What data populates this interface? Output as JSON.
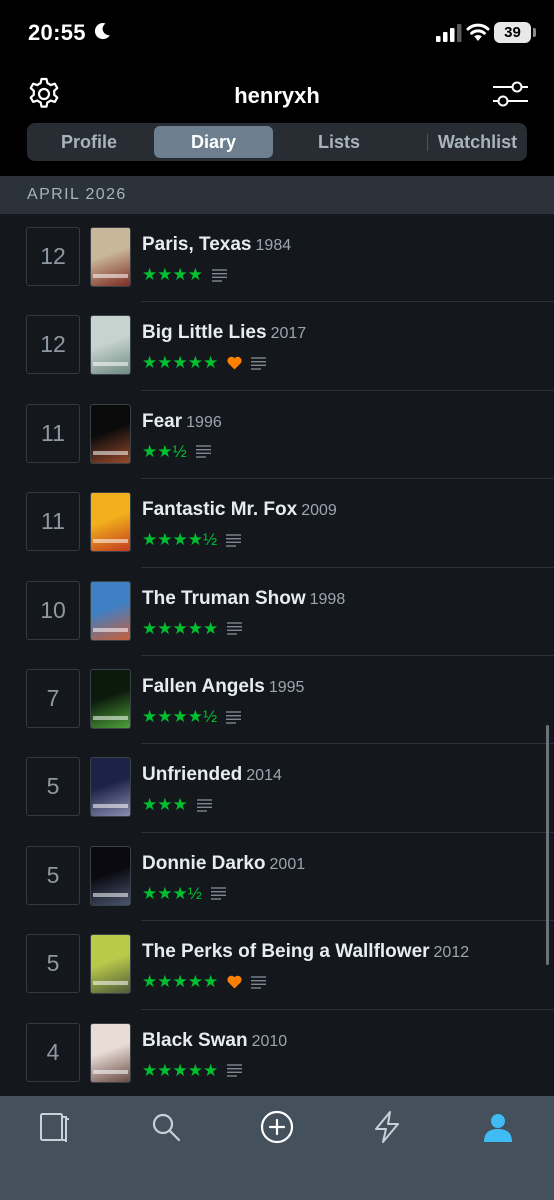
{
  "status_bar": {
    "time": "20:55",
    "battery": "39"
  },
  "header": {
    "username": "henryxh"
  },
  "tabs": [
    {
      "label": "Profile"
    },
    {
      "label": "Diary"
    },
    {
      "label": "Lists"
    },
    {
      "label": "Watchlist"
    }
  ],
  "active_tab": "Diary",
  "month_header": "APRIL 2026",
  "entries": [
    {
      "day": "12",
      "title": "Paris, Texas",
      "year": "1984",
      "rating": "★★★★",
      "liked": false,
      "poster_colors": [
        "#c9b79a",
        "#7c2a22"
      ]
    },
    {
      "day": "12",
      "title": "Big Little Lies",
      "year": "2017",
      "rating": "★★★★★",
      "liked": true,
      "poster_colors": [
        "#c7d3cf",
        "#6f8a83"
      ]
    },
    {
      "day": "11",
      "title": "Fear",
      "year": "1996",
      "rating": "★★½",
      "liked": false,
      "poster_colors": [
        "#0b0b0b",
        "#9a4a2c"
      ]
    },
    {
      "day": "11",
      "title": "Fantastic Mr. Fox",
      "year": "2009",
      "rating": "★★★★½",
      "liked": false,
      "poster_colors": [
        "#f2b11c",
        "#c23a1e"
      ]
    },
    {
      "day": "10",
      "title": "The Truman Show",
      "year": "1998",
      "rating": "★★★★★",
      "liked": false,
      "poster_colors": [
        "#3f7fc4",
        "#c95f38"
      ]
    },
    {
      "day": "7",
      "title": "Fallen Angels",
      "year": "1995",
      "rating": "★★★★½",
      "liked": false,
      "poster_colors": [
        "#0c1a0c",
        "#4fa23a"
      ]
    },
    {
      "day": "5",
      "title": "Unfriended",
      "year": "2014",
      "rating": "★★★",
      "liked": false,
      "poster_colors": [
        "#1d2247",
        "#8b8fb2"
      ]
    },
    {
      "day": "5",
      "title": "Donnie Darko",
      "year": "2001",
      "rating": "★★★½",
      "liked": false,
      "poster_colors": [
        "#0a0a10",
        "#4a5470"
      ]
    },
    {
      "day": "5",
      "title": "The Perks of Being a Wallflower",
      "year": "2012",
      "rating": "★★★★★",
      "liked": true,
      "poster_colors": [
        "#b9c94a",
        "#4f5a3a"
      ]
    },
    {
      "day": "4",
      "title": "Black Swan",
      "year": "2010",
      "rating": "★★★★★",
      "liked": false,
      "poster_colors": [
        "#e8dcd6",
        "#6a4a44"
      ]
    }
  ],
  "colors": {
    "rating_green": "#00c030",
    "like_orange": "#ff8000",
    "active_nav_blue": "#40bcf4",
    "active_segment": "#6d7f8e"
  },
  "nav_icons": [
    "films-icon",
    "search-icon",
    "add-icon",
    "activity-icon",
    "profile-icon"
  ]
}
